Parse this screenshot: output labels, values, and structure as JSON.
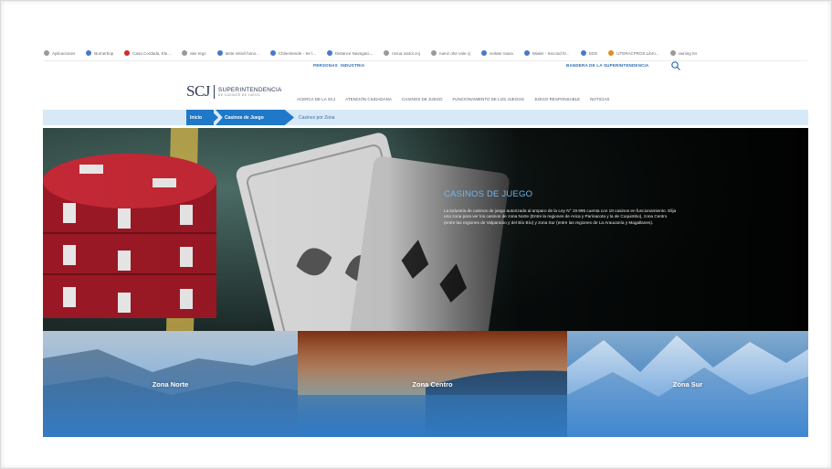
{
  "bookmarks": [
    {
      "label": "Aplicaciones",
      "icon": "apps-icon",
      "color": "#9a9a9a"
    },
    {
      "label": "Burnerbop",
      "icon": "globe-icon",
      "color": "#4a78c8"
    },
    {
      "label": "Casa Cordada, Ele...",
      "icon": "site-icon",
      "color": "#c9302c"
    },
    {
      "label": "ake ergo",
      "icon": "site-icon",
      "color": "#9a9a9a"
    },
    {
      "label": "taste mitivil hono...",
      "icon": "globe-icon",
      "color": "#4a78c8"
    },
    {
      "label": "ChileAtiende - Se l...",
      "icon": "site-icon",
      "color": "#4a78c8"
    },
    {
      "label": "Distance Navegaci...",
      "icon": "globe-icon",
      "color": "#4a78c8"
    },
    {
      "label": "nsrua rastor.zoj",
      "icon": "site-icon",
      "color": "#9a9a9a"
    },
    {
      "label": "ruenz ohe vale zj",
      "icon": "site-icon",
      "color": "#9a9a9a"
    },
    {
      "label": "ceitate roava",
      "icon": "globe-icon",
      "color": "#4a78c8"
    },
    {
      "label": "Wialer - Second hr...",
      "icon": "globe-icon",
      "color": "#4a78c8"
    },
    {
      "label": "SDG",
      "icon": "globe-icon",
      "color": "#4a78c8"
    },
    {
      "label": "UTERACPROS Libro...",
      "icon": "site-icon",
      "color": "#e68a1e"
    },
    {
      "label": "owning Ks",
      "icon": "site-icon",
      "color": "#9a9a9a"
    }
  ],
  "toplinks": {
    "link1": "PERSONAS",
    "link2": "INDUSTRIA",
    "link3": "BANDERA DE LA SUPERINTENDENCIA"
  },
  "logo": {
    "mark": "SCJ",
    "line1": "SUPERINTENDENCIA",
    "line2": "DE CASINOS DE JUEGO"
  },
  "nav": {
    "items": [
      "ACERCA DE LA SCJ",
      "ATENCIÓN CIUDADANA",
      "CASINOS DE JUEGO",
      "FUNCIONAMIENTO DE LOS JUEGOS",
      "JUEGO RESPONSABLE",
      "NOTICIAS"
    ]
  },
  "breadcrumb": {
    "home": "Inicio",
    "section": "Casinos de Juego",
    "current": "Casinos por Zona"
  },
  "hero": {
    "title": "CASINOS DE JUEGO",
    "body": "La industria de casinos de juego autorizada al amparo de la Ley N° 19.995 cuenta con 18 casinos en funcionamiento. Elija una zona para ver los casinos de zona Norte (Entre la regiones de Arica y Parinacota y la de Coquimbo), zona Centro (entre las regiones de Valparaíso y del Bío Bío) y zona Sur (entre las regiones de La Araucanía y Magallanes)."
  },
  "zones": {
    "north": "Zona Norte",
    "center": "Zona Centro",
    "south": "Zona Sur"
  },
  "colors": {
    "accent": "#1f78c8",
    "breadcrumb_bg": "#d7e9f7",
    "hero_title": "#6fb6ee",
    "chip_red": "#b3202e"
  }
}
